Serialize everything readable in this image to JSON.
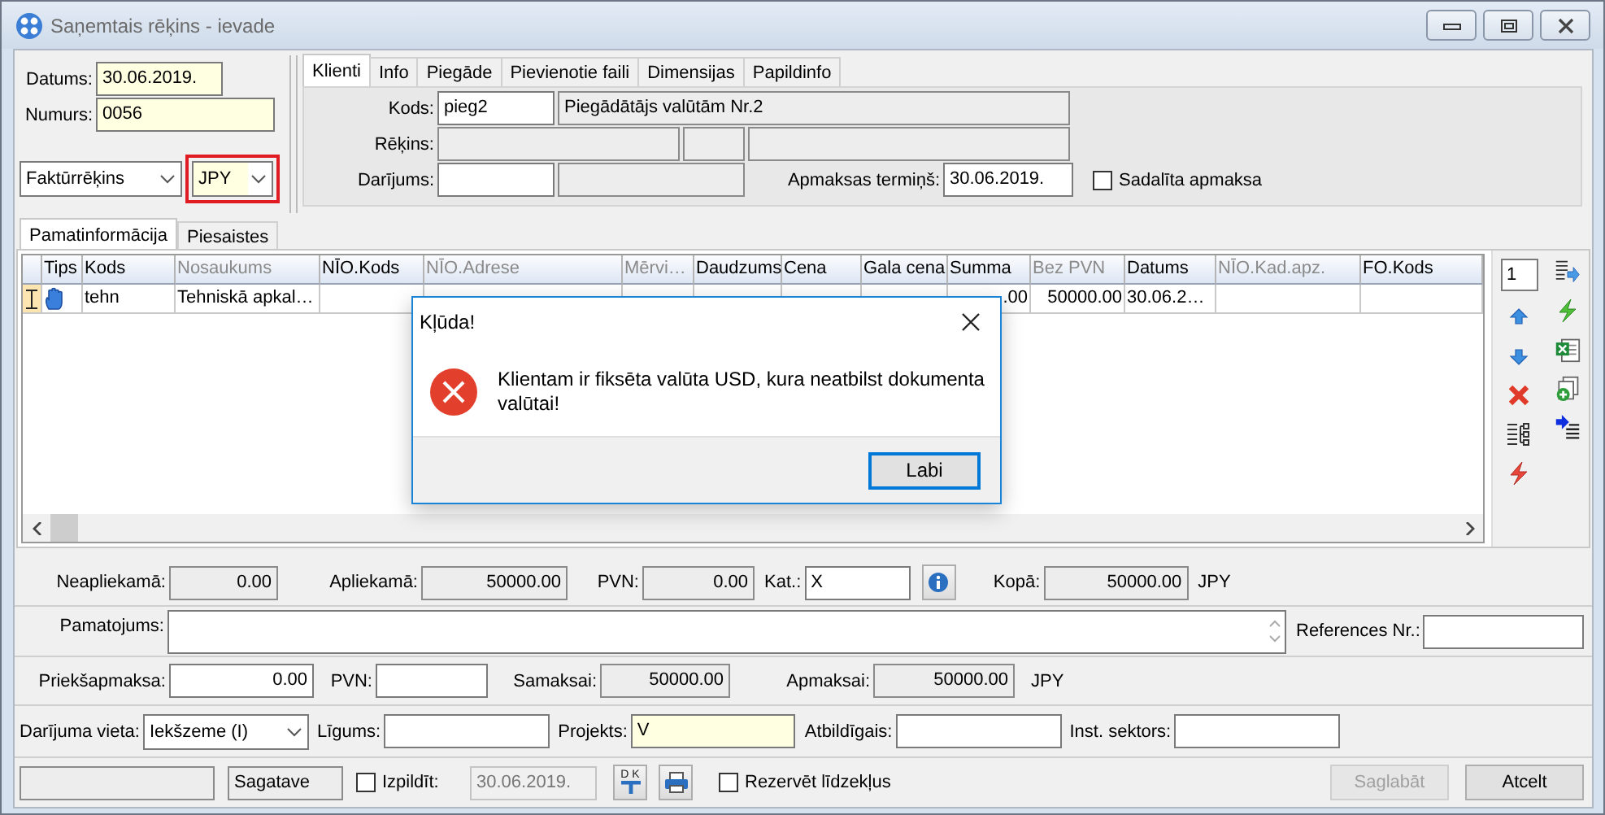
{
  "window": {
    "title": "Saņemtais rēķins - ievade"
  },
  "header": {
    "date": {
      "label": "Datums:",
      "value": "30.06.2019.",
      "required": true
    },
    "number": {
      "label": "Numurs:",
      "value": "0056",
      "required": true
    },
    "doc_type": {
      "value": "Faktūrrēķins"
    },
    "currency": {
      "value": "JPY",
      "required": true,
      "highlighted": true
    }
  },
  "client_tabs": [
    {
      "label": "Klienti",
      "selected": true
    },
    {
      "label": "Info",
      "selected": false
    },
    {
      "label": "Piegāde",
      "selected": false
    },
    {
      "label": "Pievienotie faili",
      "selected": false
    },
    {
      "label": "Dimensijas",
      "selected": false
    },
    {
      "label": "Papildinfo",
      "selected": false
    }
  ],
  "client": {
    "code": {
      "label": "Kods:",
      "value": "pieg2"
    },
    "name": {
      "value": "Piegādātājs valūtām Nr.2",
      "readonly": true
    },
    "invoice": {
      "label": "Rēķins:"
    },
    "deal": {
      "label": "Darījums:"
    },
    "term": {
      "label": "Apmaksas termiņš:",
      "value": "30.06.2019."
    },
    "split": {
      "label": "Sadalīta apmaksa",
      "checked": false
    }
  },
  "main_tabs": [
    {
      "label": "Pamatinformācija",
      "selected": true
    },
    {
      "label": "Piesaistes",
      "selected": false
    }
  ],
  "table": {
    "columns": [
      {
        "label": "Tips",
        "muted": false
      },
      {
        "label": "Kods",
        "muted": false
      },
      {
        "label": "Nosaukums",
        "muted": true
      },
      {
        "label": "NĪO.Kods",
        "muted": false
      },
      {
        "label": "NĪO.Adrese",
        "muted": true
      },
      {
        "label": "Mērvi…",
        "muted": true
      },
      {
        "label": "Daudzums",
        "muted": false
      },
      {
        "label": "Cena",
        "muted": false
      },
      {
        "label": "Gala cena",
        "muted": false
      },
      {
        "label": "Summa",
        "muted": false
      },
      {
        "label": "Bez PVN",
        "muted": true
      },
      {
        "label": "Datums",
        "muted": false
      },
      {
        "label": "NĪO.Kad.apz.",
        "muted": true
      },
      {
        "label": "FO.Kods",
        "muted": false
      }
    ],
    "rows": [
      {
        "current": true,
        "cells": [
          null,
          "tehn",
          "Tehniskā apkal…",
          null,
          null,
          null,
          null,
          null,
          null,
          ".00",
          "50000.00",
          "30.06.2…",
          null,
          null
        ]
      }
    ]
  },
  "row_counter": "1",
  "summary": {
    "untaxed": {
      "label": "Neapliekamā:",
      "value": "0.00",
      "readonly": true
    },
    "taxed": {
      "label": "Apliekamā:",
      "value": "50000.00",
      "readonly": true
    },
    "vat": {
      "label": "PVN:",
      "value": "0.00",
      "readonly": true
    },
    "category": {
      "label": "Kat.:",
      "value": "X"
    },
    "total": {
      "label": "Kopā:",
      "value": "50000.00",
      "readonly": true
    },
    "total_currency": "JPY",
    "reason": {
      "label": "Pamatojums:"
    },
    "reference": {
      "label": "References Nr.:"
    },
    "prepayment": {
      "label": "Priekšapmaksa:",
      "value": "0.00"
    },
    "prepayment_vat": {
      "label": "PVN:"
    },
    "to_pay": {
      "label": "Samaksai:",
      "value": "50000.00",
      "readonly": true
    },
    "payable": {
      "label": "Apmaksai:",
      "value": "50000.00",
      "readonly": true
    },
    "payable_currency": "JPY",
    "place": {
      "label": "Darījuma vieta:",
      "value": "Iekšzeme (I)"
    },
    "contract": {
      "label": "Līgums:"
    },
    "project": {
      "label": "Projekts:",
      "value": "V",
      "required": true
    },
    "responsible": {
      "label": "Atbildīgais:"
    },
    "sector": {
      "label": "Inst. sektors:"
    }
  },
  "footer": {
    "status": {
      "value": "Sagatave",
      "readonly": true
    },
    "execute": {
      "label": "Izpildīt:",
      "checked": false
    },
    "execute_date": {
      "value": "30.06.2019.",
      "disabled": true
    },
    "dk_button": {
      "label": "D K"
    },
    "reserve": {
      "label": "Rezervēt līdzekļus",
      "checked": false
    },
    "buttons": [
      {
        "label": "Saglabāt",
        "disabled": true
      },
      {
        "label": "Atcelt",
        "disabled": false
      }
    ]
  },
  "dialog": {
    "title": "Kļūda!",
    "message": "Klientam ir fiksēta valūta USD, kura neatbilst dokumenta valūtai!",
    "button": "Labi"
  }
}
